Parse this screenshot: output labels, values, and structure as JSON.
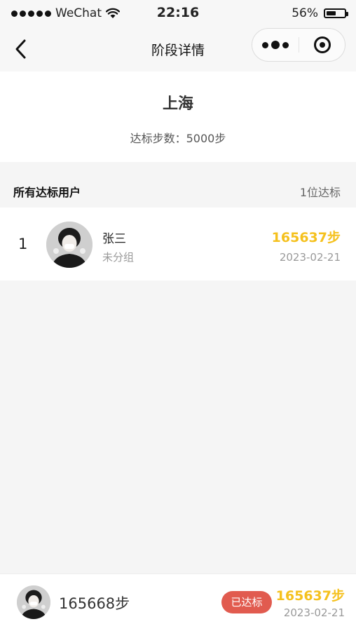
{
  "status_bar": {
    "carrier": "WeChat",
    "time": "22:16",
    "battery_percent": "56%",
    "battery_level": 0.56
  },
  "nav": {
    "title": "阶段详情"
  },
  "stage": {
    "city": "上海",
    "threshold": "达标步数：5000步"
  },
  "section": {
    "title": "所有达标用户",
    "count": "1位达标"
  },
  "users": [
    {
      "rank": "1",
      "name": "张三",
      "group": "未分组",
      "steps": "165637步",
      "date": "2023-02-21"
    }
  ],
  "me": {
    "total_steps": "165668步",
    "badge": "已达标",
    "steps": "165637步",
    "date": "2023-02-21"
  },
  "colors": {
    "accent_yellow": "#f5c11e",
    "badge_red": "#e15b4f"
  }
}
